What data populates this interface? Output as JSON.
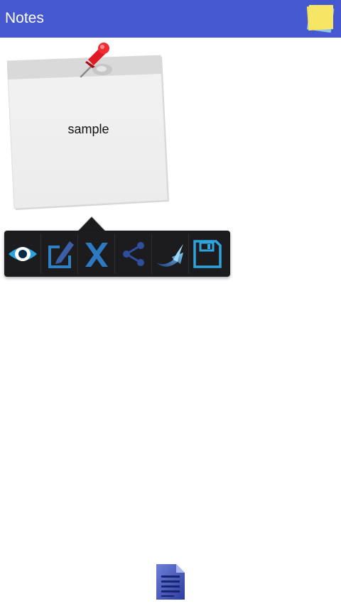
{
  "app_bar": {
    "title": "Notes",
    "background": "#4558cf",
    "logo_icon": "sticky-notes-icon"
  },
  "note": {
    "text": "sample",
    "pin_icon": "red-pushpin-icon"
  },
  "action_popup": {
    "actions": [
      {
        "name": "view",
        "icon": "eye-icon"
      },
      {
        "name": "edit",
        "icon": "edit-icon"
      },
      {
        "name": "delete",
        "icon": "x-icon"
      },
      {
        "name": "share",
        "icon": "share-icon"
      },
      {
        "name": "move",
        "icon": "swoosh-arrow-icon"
      },
      {
        "name": "save",
        "icon": "floppy-disk-icon"
      }
    ]
  },
  "bottom": {
    "icon": "document-icon"
  }
}
